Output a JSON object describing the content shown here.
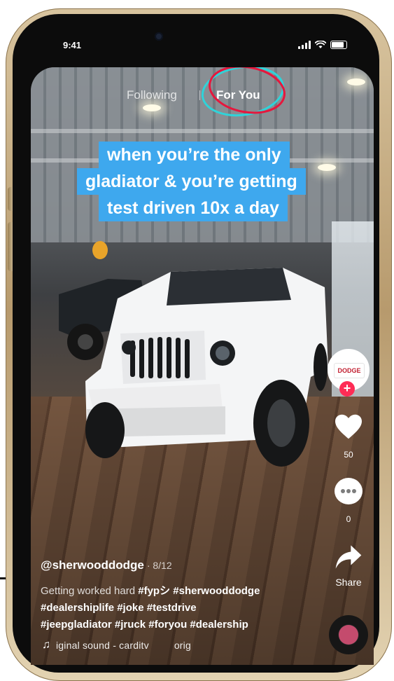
{
  "status": {
    "time": "9:41"
  },
  "tabs": {
    "following": "Following",
    "for_you": "For You"
  },
  "caption_lines": [
    "when you’re the only",
    "gladiator & you’re getting",
    "test driven 10x a day"
  ],
  "creator": {
    "avatar_text": "DODGE",
    "username": "@sherwooddodge",
    "date": "· 8/12"
  },
  "actions": {
    "likes": "50",
    "comments": "0",
    "share": "Share"
  },
  "description": {
    "lead": "Getting worked hard ",
    "line1_tags": "#fypシ #sherwooddodge",
    "line2_tags": "#dealershiplife #joke #testdrive",
    "line3_tags": "#jeepgladiator #jruck #foryou #dealership"
  },
  "sound": {
    "left": "iginal sound - carditv",
    "right": "orig"
  },
  "colors": {
    "caption_bg": "#3ea8ee",
    "follow_plus": "#fe2c55",
    "tab_circle_red": "#e6173d",
    "tab_circle_cyan": "#2fd3d9"
  },
  "icons": [
    "signal-icon",
    "wifi-icon",
    "battery-icon",
    "heart-icon",
    "comment-icon",
    "share-icon",
    "music-note-icon"
  ]
}
